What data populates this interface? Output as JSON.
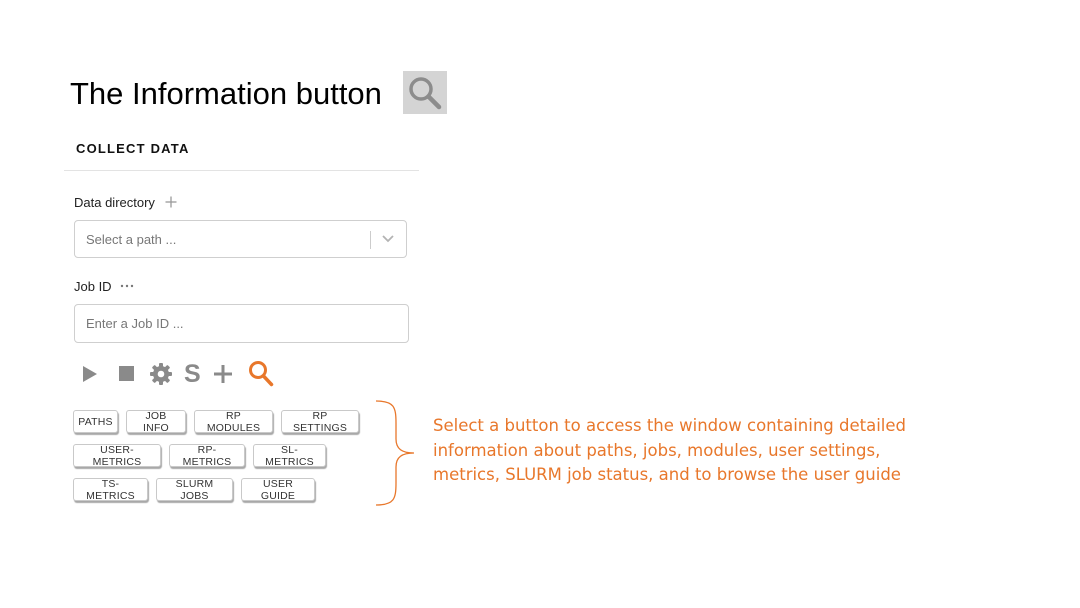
{
  "slide": {
    "title": "The Information button",
    "title_icon": "magnifier-icon"
  },
  "panel": {
    "section_title": "COLLECT DATA",
    "data_directory": {
      "label": "Data directory",
      "add_icon": "plus-icon",
      "placeholder": "Select a path ..."
    },
    "job_id": {
      "label": "Job ID",
      "more_icon": "ellipsis-icon",
      "placeholder": "Enter a Job ID ..."
    },
    "toolbar": {
      "icons": [
        "play-icon",
        "stop-icon",
        "gear-icon",
        "slurm-s-icon",
        "plus-icon",
        "search-icon"
      ],
      "s_glyph": "S"
    },
    "info_buttons": [
      {
        "label": "PATHS"
      },
      {
        "label": "JOB INFO"
      },
      {
        "label": "RP MODULES"
      },
      {
        "label": "RP SETTINGS"
      },
      {
        "label": "USER-METRICS"
      },
      {
        "label": "RP-METRICS"
      },
      {
        "label": "SL-METRICS"
      },
      {
        "label": "TS-METRICS"
      },
      {
        "label": "SLURM JOBS"
      },
      {
        "label": "USER GUIDE"
      }
    ]
  },
  "annotation": {
    "lines": [
      "Select a button to access the window containing detailed",
      "information about paths, jobs, modules, user settings,",
      "metrics, SLURM job status, and to browse the user guide"
    ]
  },
  "colors": {
    "accent": "#e8772b",
    "icon_gray": "#8a8a8a",
    "title_icon_bg": "#d4d4d4"
  }
}
